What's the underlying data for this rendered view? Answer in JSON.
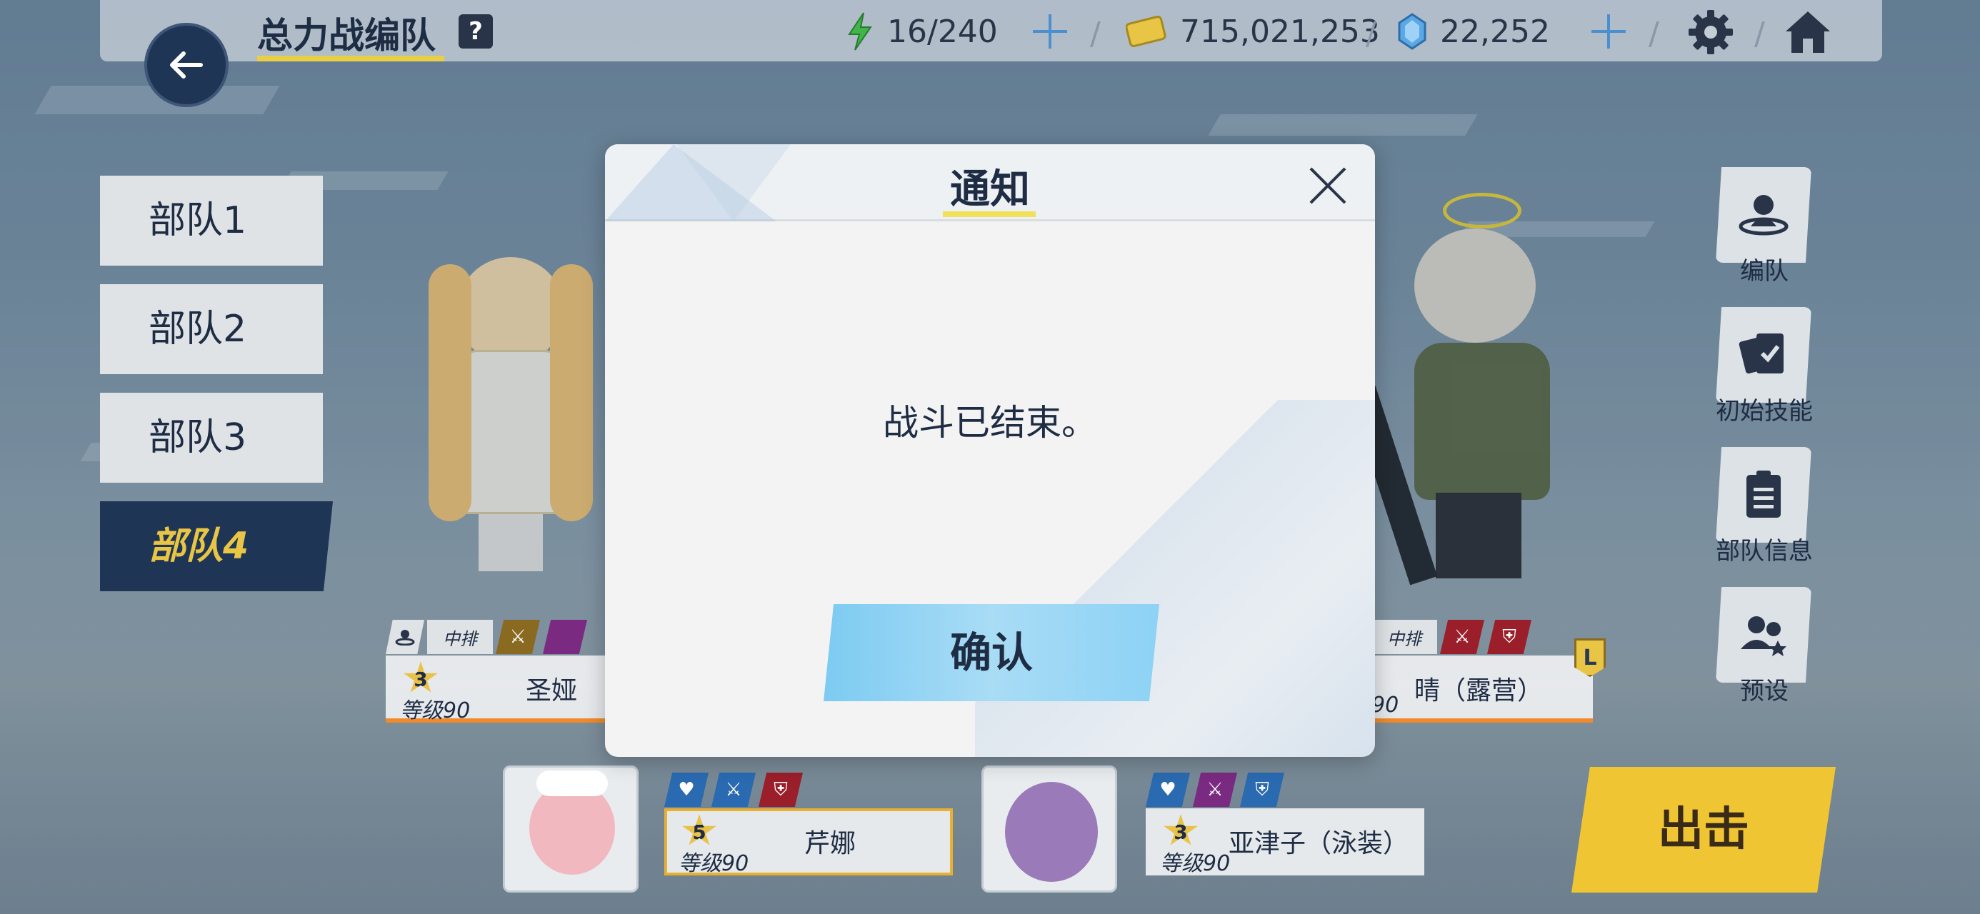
{
  "header": {
    "title": "总力战编队",
    "help": "?",
    "stamina": "16/240",
    "credits": "715,021,253",
    "gems": "22,252",
    "separator": "/"
  },
  "squads": [
    {
      "label": "部队1",
      "active": false
    },
    {
      "label": "部队2",
      "active": false
    },
    {
      "label": "部队3",
      "active": false
    },
    {
      "label": "部队4",
      "active": true
    }
  ],
  "units_front": [
    {
      "position": "中排",
      "stars": "3",
      "level": "等级90",
      "name": "圣娅"
    },
    {
      "position": "中排",
      "level": "90",
      "name": "晴（露营）",
      "leader_badge": "L"
    }
  ],
  "units_support": [
    {
      "stars": "5",
      "level": "等级90",
      "name": "芹娜"
    },
    {
      "stars": "3",
      "level": "等级90",
      "name": "亚津子（泳装）"
    }
  ],
  "side_menu": [
    {
      "label": "编队",
      "icon": "formation-icon"
    },
    {
      "label": "初始技能",
      "icon": "skill-cards-icon"
    },
    {
      "label": "部队信息",
      "icon": "clipboard-icon"
    },
    {
      "label": "预设",
      "icon": "preset-users-icon"
    }
  ],
  "launch_label": "出击",
  "dialog": {
    "title": "通知",
    "message": "战斗已结束。",
    "confirm_label": "确认"
  },
  "colors": {
    "navy": "#1f3555",
    "gold": "#e8c545",
    "accent_blue": "#4c8fd0",
    "confirm": "#8dd2f5",
    "launch": "#f0c534",
    "orange_line": "#f08a2a"
  }
}
